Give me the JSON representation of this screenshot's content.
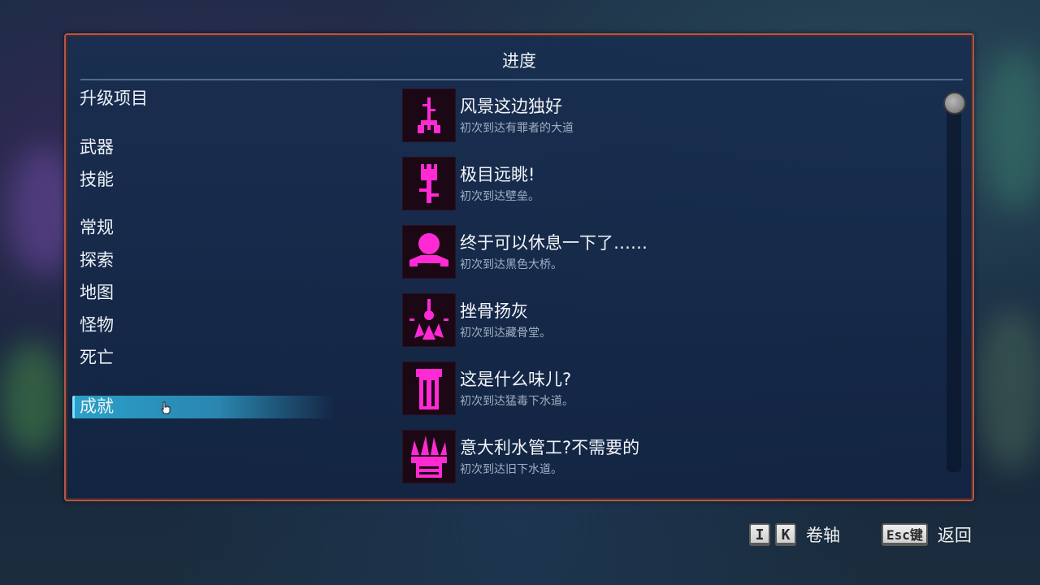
{
  "title": "进度",
  "categories": [
    {
      "label": "升级项目"
    },
    {
      "label": "武器"
    },
    {
      "label": "技能"
    },
    {
      "label": "常规"
    },
    {
      "label": "探索"
    },
    {
      "label": "地图"
    },
    {
      "label": "怪物"
    },
    {
      "label": "死亡"
    },
    {
      "label": "成就"
    }
  ],
  "selected_category": "成就",
  "achievements": [
    {
      "title": "风景这边独好",
      "description": "初次到达有罪者的大道",
      "icon": "thorned-tree-icon"
    },
    {
      "title": "极目远眺!",
      "description": "初次到达壁垒。",
      "icon": "tower-icon"
    },
    {
      "title": "终于可以休息一下了……",
      "description": "初次到达黑色大桥。",
      "icon": "bridge-icon"
    },
    {
      "title": "挫骨扬灰",
      "description": "初次到达藏骨堂。",
      "icon": "ossuary-icon"
    },
    {
      "title": "这是什么味儿?",
      "description": "初次到达猛毒下水道。",
      "icon": "pipe-icon"
    },
    {
      "title": "意大利水管工?不需要的",
      "description": "初次到达旧下水道。",
      "icon": "sewer-grate-icon"
    }
  ],
  "footer": {
    "scroll_keys": [
      "I",
      "K"
    ],
    "scroll_label": "卷轴",
    "back_key": "Esc键",
    "back_label": "返回"
  },
  "colors": {
    "accent": "#2aa0c8",
    "icon_magenta": "#ff2ad4",
    "panel_border": "#b0584a"
  }
}
